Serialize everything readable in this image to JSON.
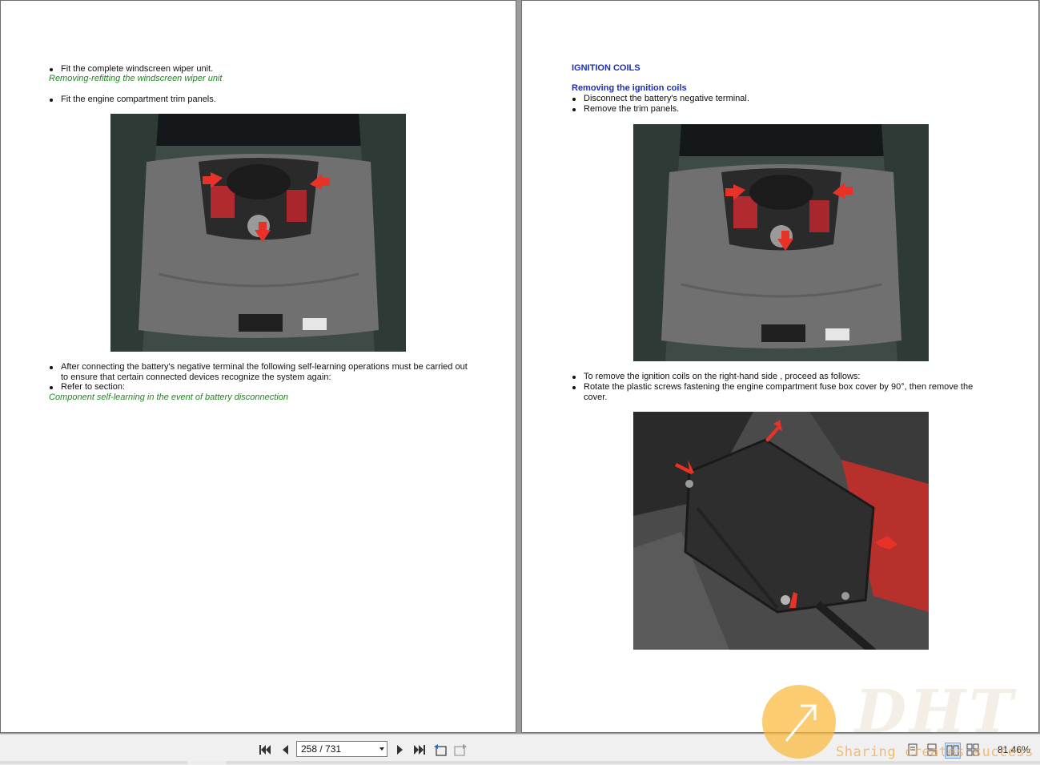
{
  "left_page": {
    "bullet_1": "Fit the complete windscreen wiper unit.",
    "link_1": "Removing-refitting the windscreen wiper unit",
    "bullet_2": "Fit the engine compartment trim panels.",
    "bullet_3a": "After connecting the battery's negative terminal the following self-learning operations must be carried out",
    "bullet_3b": "to ensure that certain connected devices recognize the system again:",
    "bullet_4": "Refer to section:",
    "link_2": "Component self-learning in the event of battery disconnection"
  },
  "right_page": {
    "heading": "IGNITION COILS",
    "subheading": "Removing the ignition coils",
    "bullet_1": "Disconnect the battery's negative terminal.",
    "bullet_2": "Remove the trim panels.",
    "bullet_3": "To remove the ignition coils on the right-hand side , proceed as follows:",
    "bullet_4a": "Rotate the plastic screws fastening the engine compartment fuse box cover by 90°, then remove the",
    "bullet_4b": "cover."
  },
  "toolbar": {
    "page_value": "258 / 731",
    "zoom": "81.46%",
    "icons": [
      "first-page-icon",
      "previous-page-icon",
      "next-page-icon",
      "last-page-icon",
      "previous-view-icon",
      "next-view-icon",
      "single-page-icon",
      "single-continuous-icon",
      "facing-pages-icon",
      "facing-continuous-icon"
    ]
  },
  "watermark": {
    "logo": "DHT",
    "tagline": "Sharing creates success"
  },
  "colors": {
    "heading": "#1a2dbf",
    "link": "#1a8a1a",
    "arrow": "#e83228"
  }
}
